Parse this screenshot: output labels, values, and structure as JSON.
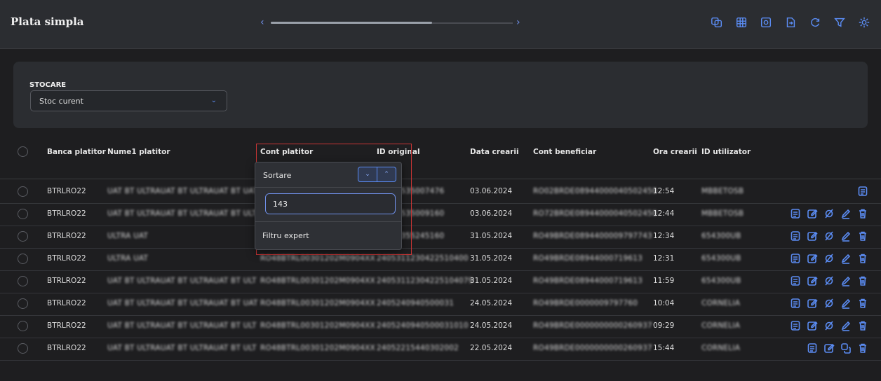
{
  "app": {
    "title": "Plata simpla"
  },
  "scroll": {
    "left": "‹",
    "right": "›"
  },
  "toolbar_icons": [
    "copy-icon",
    "grid-icon",
    "target-icon",
    "export-icon",
    "refresh-icon",
    "filter-icon",
    "settings-icon"
  ],
  "storage": {
    "label": "STOCARE",
    "value": "Stoc curent"
  },
  "table": {
    "headers": [
      "Banca platitor",
      "Nume1 platitor",
      "Cont platitor",
      "ID original",
      "Data crearii",
      "Cont beneficiar",
      "Ora crearii",
      "ID utilizator"
    ],
    "rows": [
      {
        "bank": "BTRLRO22",
        "name": "UAT BT ULTRAUAT BT ULTRAUAT BT UAT",
        "account": "",
        "orig_id": "12743535007476",
        "date": "03.06.2024",
        "benef": "RO02BRDE08944000040502450",
        "time": "12:54",
        "user": "MBBETOSB",
        "actions": [
          "doc-icon"
        ]
      },
      {
        "bank": "BTRLRO22",
        "name": "UAT BT ULTRAUAT BT ULTRAUAT BT ULT",
        "account": "",
        "orig_id": "12743535009160",
        "date": "03.06.2024",
        "benef": "RO72BRDE08944000040502450",
        "time": "12:44",
        "user": "MBBETOSB",
        "actions": [
          "doc-icon",
          "edit-icon",
          "cancel-icon",
          "pen-icon",
          "trash-icon"
        ]
      },
      {
        "bank": "BTRLRO22",
        "name": "ULTRA UAT",
        "account": "",
        "orig_id": "12341355245160",
        "date": "31.05.2024",
        "benef": "RO49BRDE0894400009797743",
        "time": "12:34",
        "user": "654300UB",
        "actions": [
          "doc-icon",
          "edit-icon",
          "cancel-icon",
          "pen-icon",
          "trash-icon"
        ]
      },
      {
        "bank": "BTRLRO22",
        "name": "ULTRA UAT",
        "account": "RO48BTRL00301202M0904XX",
        "orig_id": "2405311230422510400",
        "date": "31.05.2024",
        "benef": "RO49BRDE08944000719613",
        "time": "12:31",
        "user": "654300UB",
        "actions": [
          "doc-icon",
          "edit-icon",
          "cancel-icon",
          "pen-icon",
          "trash-icon"
        ]
      },
      {
        "bank": "BTRLRO22",
        "name": "UAT BT ULTRAUAT BT ULTRAUAT BT ULT",
        "account": "RO48BTRL00301202M0904XX",
        "orig_id": "24053112304225104079",
        "date": "31.05.2024",
        "benef": "RO49BRDE08944000719613",
        "time": "11:59",
        "user": "654300UB",
        "actions": [
          "doc-icon",
          "edit-icon",
          "cancel-icon",
          "pen-icon",
          "trash-icon"
        ]
      },
      {
        "bank": "BTRLRO22",
        "name": "UAT BT ULTRAUAT BT ULTRAUAT BT UAT",
        "account": "RO48BTRL00301202M0904XX",
        "orig_id": "2405240940500031",
        "date": "24.05.2024",
        "benef": "RO49BRDE0000009797760",
        "time": "10:04",
        "user": "CORNELIA",
        "actions": [
          "doc-icon",
          "edit-icon",
          "cancel-icon",
          "pen-icon",
          "trash-icon"
        ]
      },
      {
        "bank": "BTRLRO22",
        "name": "UAT BT ULTRAUAT BT ULTRAUAT BT ULT",
        "account": "RO48BTRL00301202M0904XX",
        "orig_id": "2405240940500031010",
        "date": "24.05.2024",
        "benef": "RO49BRDE0000000000260937",
        "time": "09:29",
        "user": "CORNELIA",
        "actions": [
          "doc-icon",
          "edit-icon",
          "cancel-icon",
          "pen-icon",
          "trash-icon"
        ]
      },
      {
        "bank": "BTRLRO22",
        "name": "UAT BT ULTRAUAT BT ULTRAUAT BT ULT",
        "account": "RO48BTRL00301202M0904XX",
        "orig_id": "24052215440302002",
        "date": "22.05.2024",
        "benef": "RO49BRDE0000000000260937",
        "time": "15:44",
        "user": "CORNELIA",
        "actions": [
          "doc-icon",
          "edit-icon",
          "copy-plus-icon",
          "trash-icon"
        ]
      }
    ]
  },
  "popup": {
    "sort_label": "Sortare",
    "sort_desc": "⌄",
    "sort_asc": "⌃",
    "search_value": "143",
    "expert_label": "Filtru expert"
  },
  "colors": {
    "accent": "#5b8cf3",
    "highlight": "#c93535",
    "background": "#1e1e20"
  }
}
